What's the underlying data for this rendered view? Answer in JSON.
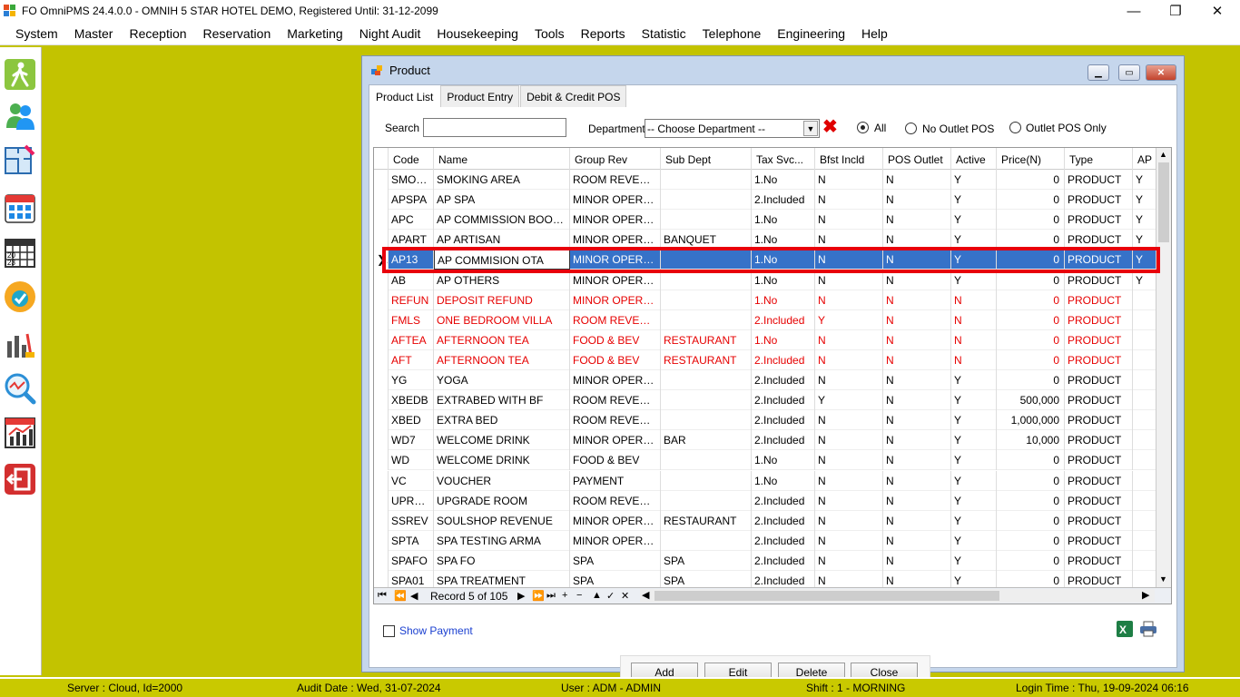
{
  "window": {
    "title": "FO OmniPMS 24.4.0.0 - OMNIH 5 STAR HOTEL DEMO, Registered Until: 31-12-2099",
    "minimize": "—",
    "restore": "❐",
    "close": "✕"
  },
  "menu": [
    "System",
    "Master",
    "Reception",
    "Reservation",
    "Marketing",
    "Night Audit",
    "Housekeeping",
    "Tools",
    "Reports",
    "Statistic",
    "Telephone",
    "Engineering",
    "Help"
  ],
  "sidebar": [
    "walk-in-icon",
    "guests-icon",
    "floor-plan-icon",
    "calendar-icon",
    "year-calendar-icon",
    "available-badge-icon",
    "housekeeping-icon",
    "search-analysis-icon",
    "statistics-chart-icon",
    "exit-icon"
  ],
  "product": {
    "title": "Product",
    "tabs": [
      "Product List",
      "Product Entry",
      "Debit & Credit POS"
    ],
    "search_label": "Search",
    "search_value": "",
    "department_label": "Department",
    "department_value": "-- Choose Department --",
    "radio_all": "All",
    "radio_no_outlet": "No Outlet POS",
    "radio_outlet_only": "Outlet POS Only",
    "columns": [
      "Code",
      "Name",
      "Group Rev",
      "Sub Dept",
      "Tax Svc...",
      "Bfst Incld",
      "POS Outlet",
      "Active",
      "Price(N)",
      "Type",
      "AP"
    ],
    "rows": [
      {
        "code": "SMOKA",
        "name": "SMOKING AREA",
        "group": "ROOM REVENUE",
        "sub": "",
        "tax": "1.No",
        "bfst": "N",
        "pos": "N",
        "active": "Y",
        "price": "0",
        "type": "PRODUCT",
        "ap": "Y",
        "red": false
      },
      {
        "code": "APSPA",
        "name": "AP SPA",
        "group": "MINOR OPERATI...",
        "sub": "",
        "tax": "2.Included",
        "bfst": "N",
        "pos": "N",
        "active": "Y",
        "price": "0",
        "type": "PRODUCT",
        "ap": "Y",
        "red": false
      },
      {
        "code": "APC",
        "name": "AP COMMISSION BOOKING...",
        "group": "MINOR OPERATI...",
        "sub": "",
        "tax": "1.No",
        "bfst": "N",
        "pos": "N",
        "active": "Y",
        "price": "0",
        "type": "PRODUCT",
        "ap": "Y",
        "red": false
      },
      {
        "code": "APART",
        "name": "AP ARTISAN",
        "group": "MINOR OPERATI...",
        "sub": "BANQUET",
        "tax": "1.No",
        "bfst": "N",
        "pos": "N",
        "active": "Y",
        "price": "0",
        "type": "PRODUCT",
        "ap": "Y",
        "red": false
      },
      {
        "code": "AP13",
        "name": "AP COMMISION OTA",
        "group": "MINOR OPERATI...",
        "sub": "",
        "tax": "1.No",
        "bfst": "N",
        "pos": "N",
        "active": "Y",
        "price": "0",
        "type": "PRODUCT",
        "ap": "Y",
        "red": false,
        "selected": true
      },
      {
        "code": "AB",
        "name": "AP OTHERS",
        "group": "MINOR OPERATI...",
        "sub": "",
        "tax": "1.No",
        "bfst": "N",
        "pos": "N",
        "active": "Y",
        "price": "0",
        "type": "PRODUCT",
        "ap": "Y",
        "red": false
      },
      {
        "code": "REFUN",
        "name": "DEPOSIT REFUND",
        "group": "MINOR OPERATI...",
        "sub": "",
        "tax": "1.No",
        "bfst": "N",
        "pos": "N",
        "active": "N",
        "price": "0",
        "type": "PRODUCT",
        "ap": "",
        "red": true
      },
      {
        "code": "FMLS",
        "name": "ONE BEDROOM VILLA",
        "group": "ROOM REVENUE",
        "sub": "",
        "tax": "2.Included",
        "bfst": "Y",
        "pos": "N",
        "active": "N",
        "price": "0",
        "type": "PRODUCT",
        "ap": "",
        "red": true
      },
      {
        "code": "AFTEA",
        "name": "AFTERNOON TEA",
        "group": "FOOD & BEV",
        "sub": "RESTAURANT",
        "tax": "1.No",
        "bfst": "N",
        "pos": "N",
        "active": "N",
        "price": "0",
        "type": "PRODUCT",
        "ap": "",
        "red": true
      },
      {
        "code": "AFT",
        "name": "AFTERNOON TEA",
        "group": "FOOD & BEV",
        "sub": "RESTAURANT",
        "tax": "2.Included",
        "bfst": "N",
        "pos": "N",
        "active": "N",
        "price": "0",
        "type": "PRODUCT",
        "ap": "",
        "red": true
      },
      {
        "code": "YG",
        "name": "YOGA",
        "group": "MINOR OPERATI...",
        "sub": "",
        "tax": "2.Included",
        "bfst": "N",
        "pos": "N",
        "active": "Y",
        "price": "0",
        "type": "PRODUCT",
        "ap": "",
        "red": false
      },
      {
        "code": "XBEDB",
        "name": "EXTRABED WITH BF",
        "group": "ROOM REVENUE",
        "sub": "",
        "tax": "2.Included",
        "bfst": "Y",
        "pos": "N",
        "active": "Y",
        "price": "500,000",
        "type": "PRODUCT",
        "ap": "",
        "red": false
      },
      {
        "code": "XBED",
        "name": "EXTRA BED",
        "group": "ROOM REVENUE",
        "sub": "",
        "tax": "2.Included",
        "bfst": "N",
        "pos": "N",
        "active": "Y",
        "price": "1,000,000",
        "type": "PRODUCT",
        "ap": "",
        "red": false
      },
      {
        "code": "WD7",
        "name": "WELCOME DRINK",
        "group": "MINOR OPERATI...",
        "sub": "BAR",
        "tax": "2.Included",
        "bfst": "N",
        "pos": "N",
        "active": "Y",
        "price": "10,000",
        "type": "PRODUCT",
        "ap": "",
        "red": false
      },
      {
        "code": "WD",
        "name": "WELCOME DRINK",
        "group": "FOOD & BEV",
        "sub": "",
        "tax": "1.No",
        "bfst": "N",
        "pos": "N",
        "active": "Y",
        "price": "0",
        "type": "PRODUCT",
        "ap": "",
        "red": false
      },
      {
        "code": "VC",
        "name": "VOUCHER",
        "group": "PAYMENT",
        "sub": "",
        "tax": "1.No",
        "bfst": "N",
        "pos": "N",
        "active": "Y",
        "price": "0",
        "type": "PRODUCT",
        "ap": "",
        "red": false
      },
      {
        "code": "UPROM",
        "name": "UPGRADE ROOM",
        "group": "ROOM REVENUE",
        "sub": "",
        "tax": "2.Included",
        "bfst": "N",
        "pos": "N",
        "active": "Y",
        "price": "0",
        "type": "PRODUCT",
        "ap": "",
        "red": false
      },
      {
        "code": "SSREV",
        "name": "SOULSHOP REVENUE",
        "group": "MINOR OPERATI...",
        "sub": "RESTAURANT",
        "tax": "2.Included",
        "bfst": "N",
        "pos": "N",
        "active": "Y",
        "price": "0",
        "type": "PRODUCT",
        "ap": "",
        "red": false
      },
      {
        "code": "SPTA",
        "name": "SPA TESTING ARMA",
        "group": "MINOR OPERATI...",
        "sub": "",
        "tax": "2.Included",
        "bfst": "N",
        "pos": "N",
        "active": "Y",
        "price": "0",
        "type": "PRODUCT",
        "ap": "",
        "red": false
      },
      {
        "code": "SPAFO",
        "name": "SPA FO",
        "group": "SPA",
        "sub": "SPA",
        "tax": "2.Included",
        "bfst": "N",
        "pos": "N",
        "active": "Y",
        "price": "0",
        "type": "PRODUCT",
        "ap": "",
        "red": false
      },
      {
        "code": "SPA01",
        "name": "SPA TREATMENT",
        "group": "SPA",
        "sub": "SPA",
        "tax": "2.Included",
        "bfst": "N",
        "pos": "N",
        "active": "Y",
        "price": "0",
        "type": "PRODUCT",
        "ap": "",
        "red": false
      }
    ],
    "record_text": "Record 5 of 105",
    "show_payment": "Show Payment",
    "buttons": {
      "add": "Add",
      "edit": "Edit",
      "delete": "Delete",
      "close": "Close"
    }
  },
  "status": {
    "server": "Server : Cloud, Id=2000",
    "audit": "Audit Date : Wed, 31-07-2024",
    "user": "User : ADM - ADMIN",
    "shift": "Shift : 1 - MORNING",
    "login": "Login Time : Thu, 19-09-2024 06:16"
  }
}
